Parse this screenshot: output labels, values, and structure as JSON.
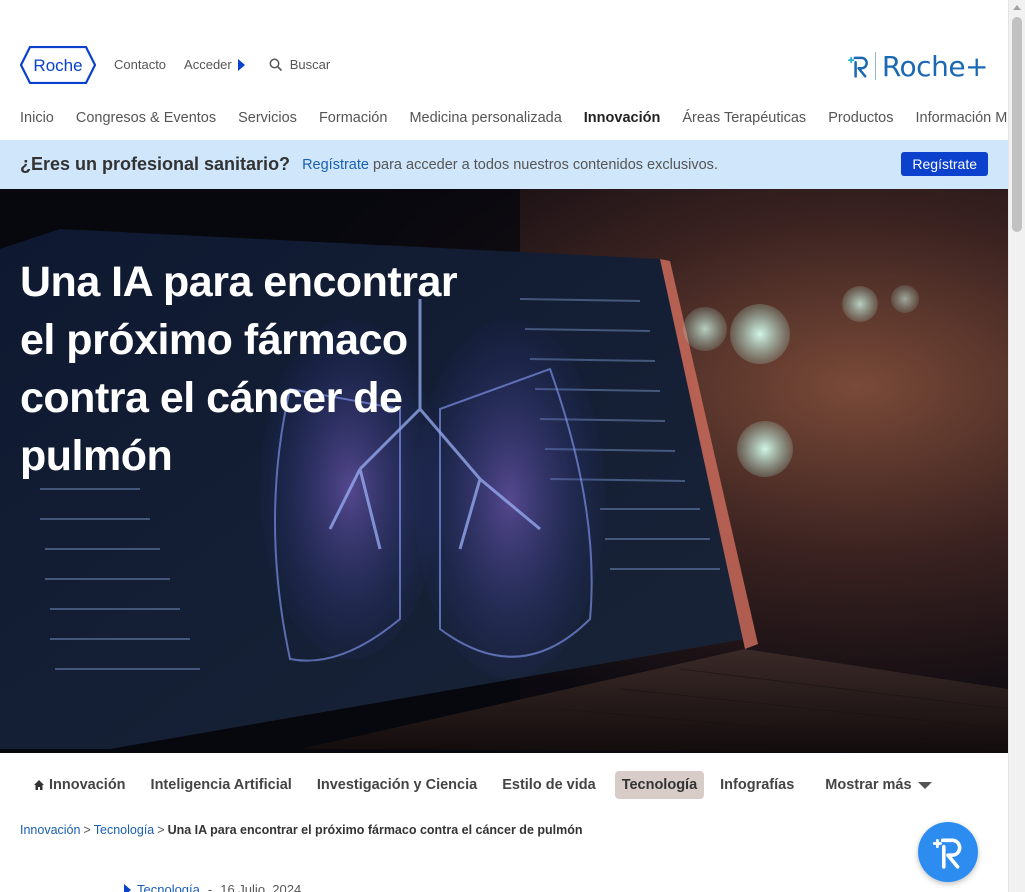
{
  "header": {
    "logo_text": "Roche",
    "contact": "Contacto",
    "login": "Acceder",
    "search_placeholder": "Buscar",
    "plus_logo_text": "Roche+"
  },
  "main_nav": {
    "items": [
      {
        "label": "Inicio",
        "active": false
      },
      {
        "label": "Congresos & Eventos",
        "active": false
      },
      {
        "label": "Servicios",
        "active": false
      },
      {
        "label": "Formación",
        "active": false
      },
      {
        "label": "Medicina personalizada",
        "active": false
      },
      {
        "label": "Innovación",
        "active": true
      },
      {
        "label": "Áreas Terapéuticas",
        "active": false
      },
      {
        "label": "Productos",
        "active": false
      },
      {
        "label": "Información Médica",
        "active": false
      }
    ]
  },
  "banner": {
    "question": "¿Eres un profesional sanitario?",
    "link": "Regístrate",
    "text": "para acceder a todos nuestros contenidos exclusivos.",
    "button": "Regístrate"
  },
  "hero": {
    "title": "Una IA para encontrar el próximo fármaco contra el cáncer de pulmón"
  },
  "sub_nav": {
    "items": [
      {
        "label": "Innovación",
        "icon": "home-icon"
      },
      {
        "label": "Inteligencia Artificial"
      },
      {
        "label": "Investigación y Ciencia"
      },
      {
        "label": "Estilo de vida"
      },
      {
        "label": "Tecnología",
        "active": true
      },
      {
        "label": "Infografías"
      }
    ],
    "more": "Mostrar más"
  },
  "breadcrumb": {
    "level1": "Innovación",
    "level2": "Tecnología",
    "current": "Una IA para encontrar el próximo fármaco contra el cáncer de pulmón",
    "separator": ">"
  },
  "article_meta": {
    "category": "Tecnología",
    "date": "16 Julio, 2024"
  },
  "colors": {
    "brand_blue": "#0b41cd",
    "banner_bg": "#cfe6fb",
    "active_tab_bg": "#d7ccc8",
    "fab_blue": "#2d8cef"
  }
}
